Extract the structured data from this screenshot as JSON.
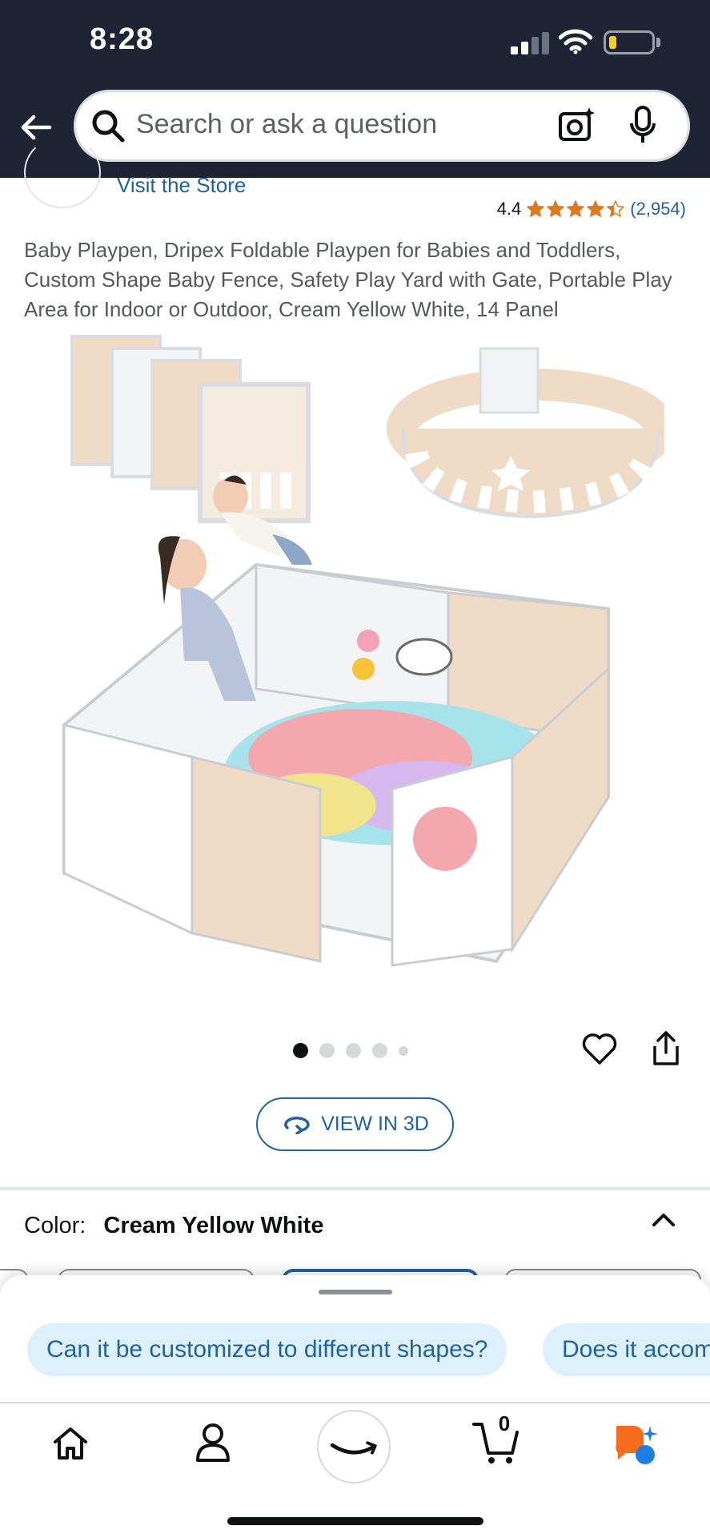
{
  "status_bar": {
    "time": "8:28",
    "battery_color": "#f2d21b"
  },
  "header": {
    "search_placeholder": "Search or ask a question",
    "icons": [
      "back-arrow-icon",
      "search-icon",
      "camera-icon",
      "microphone-icon"
    ]
  },
  "store": {
    "visit_label": "Visit the Store"
  },
  "rating": {
    "value": "4.4",
    "stars": 4.4,
    "count": "(2,954)",
    "star_color": "#de7921"
  },
  "product": {
    "title": "Baby Playpen, Dripex Foldable Playpen for Babies and Toddlers, Custom Shape Baby Fence, Safety Play Yard with Gate, Portable Play Area for Indoor or Outdoor, Cream Yellow White, 14 Panel",
    "image_count": 5,
    "active_image": 1
  },
  "actions": {
    "view_3d_label": "VIEW IN 3D"
  },
  "color": {
    "label": "Color:",
    "value": "Cream Yellow White"
  },
  "questions": [
    "Can it be customized to different shapes?",
    "Does it accom"
  ],
  "nav": {
    "cart_count": "0",
    "items": [
      "home-icon",
      "account-icon",
      "amazon-logo-button",
      "cart-icon",
      "rufus-icon"
    ]
  },
  "colors": {
    "header_bg": "#1e2433",
    "link": "#2162a1",
    "chip_bg": "#dcf1fb"
  }
}
